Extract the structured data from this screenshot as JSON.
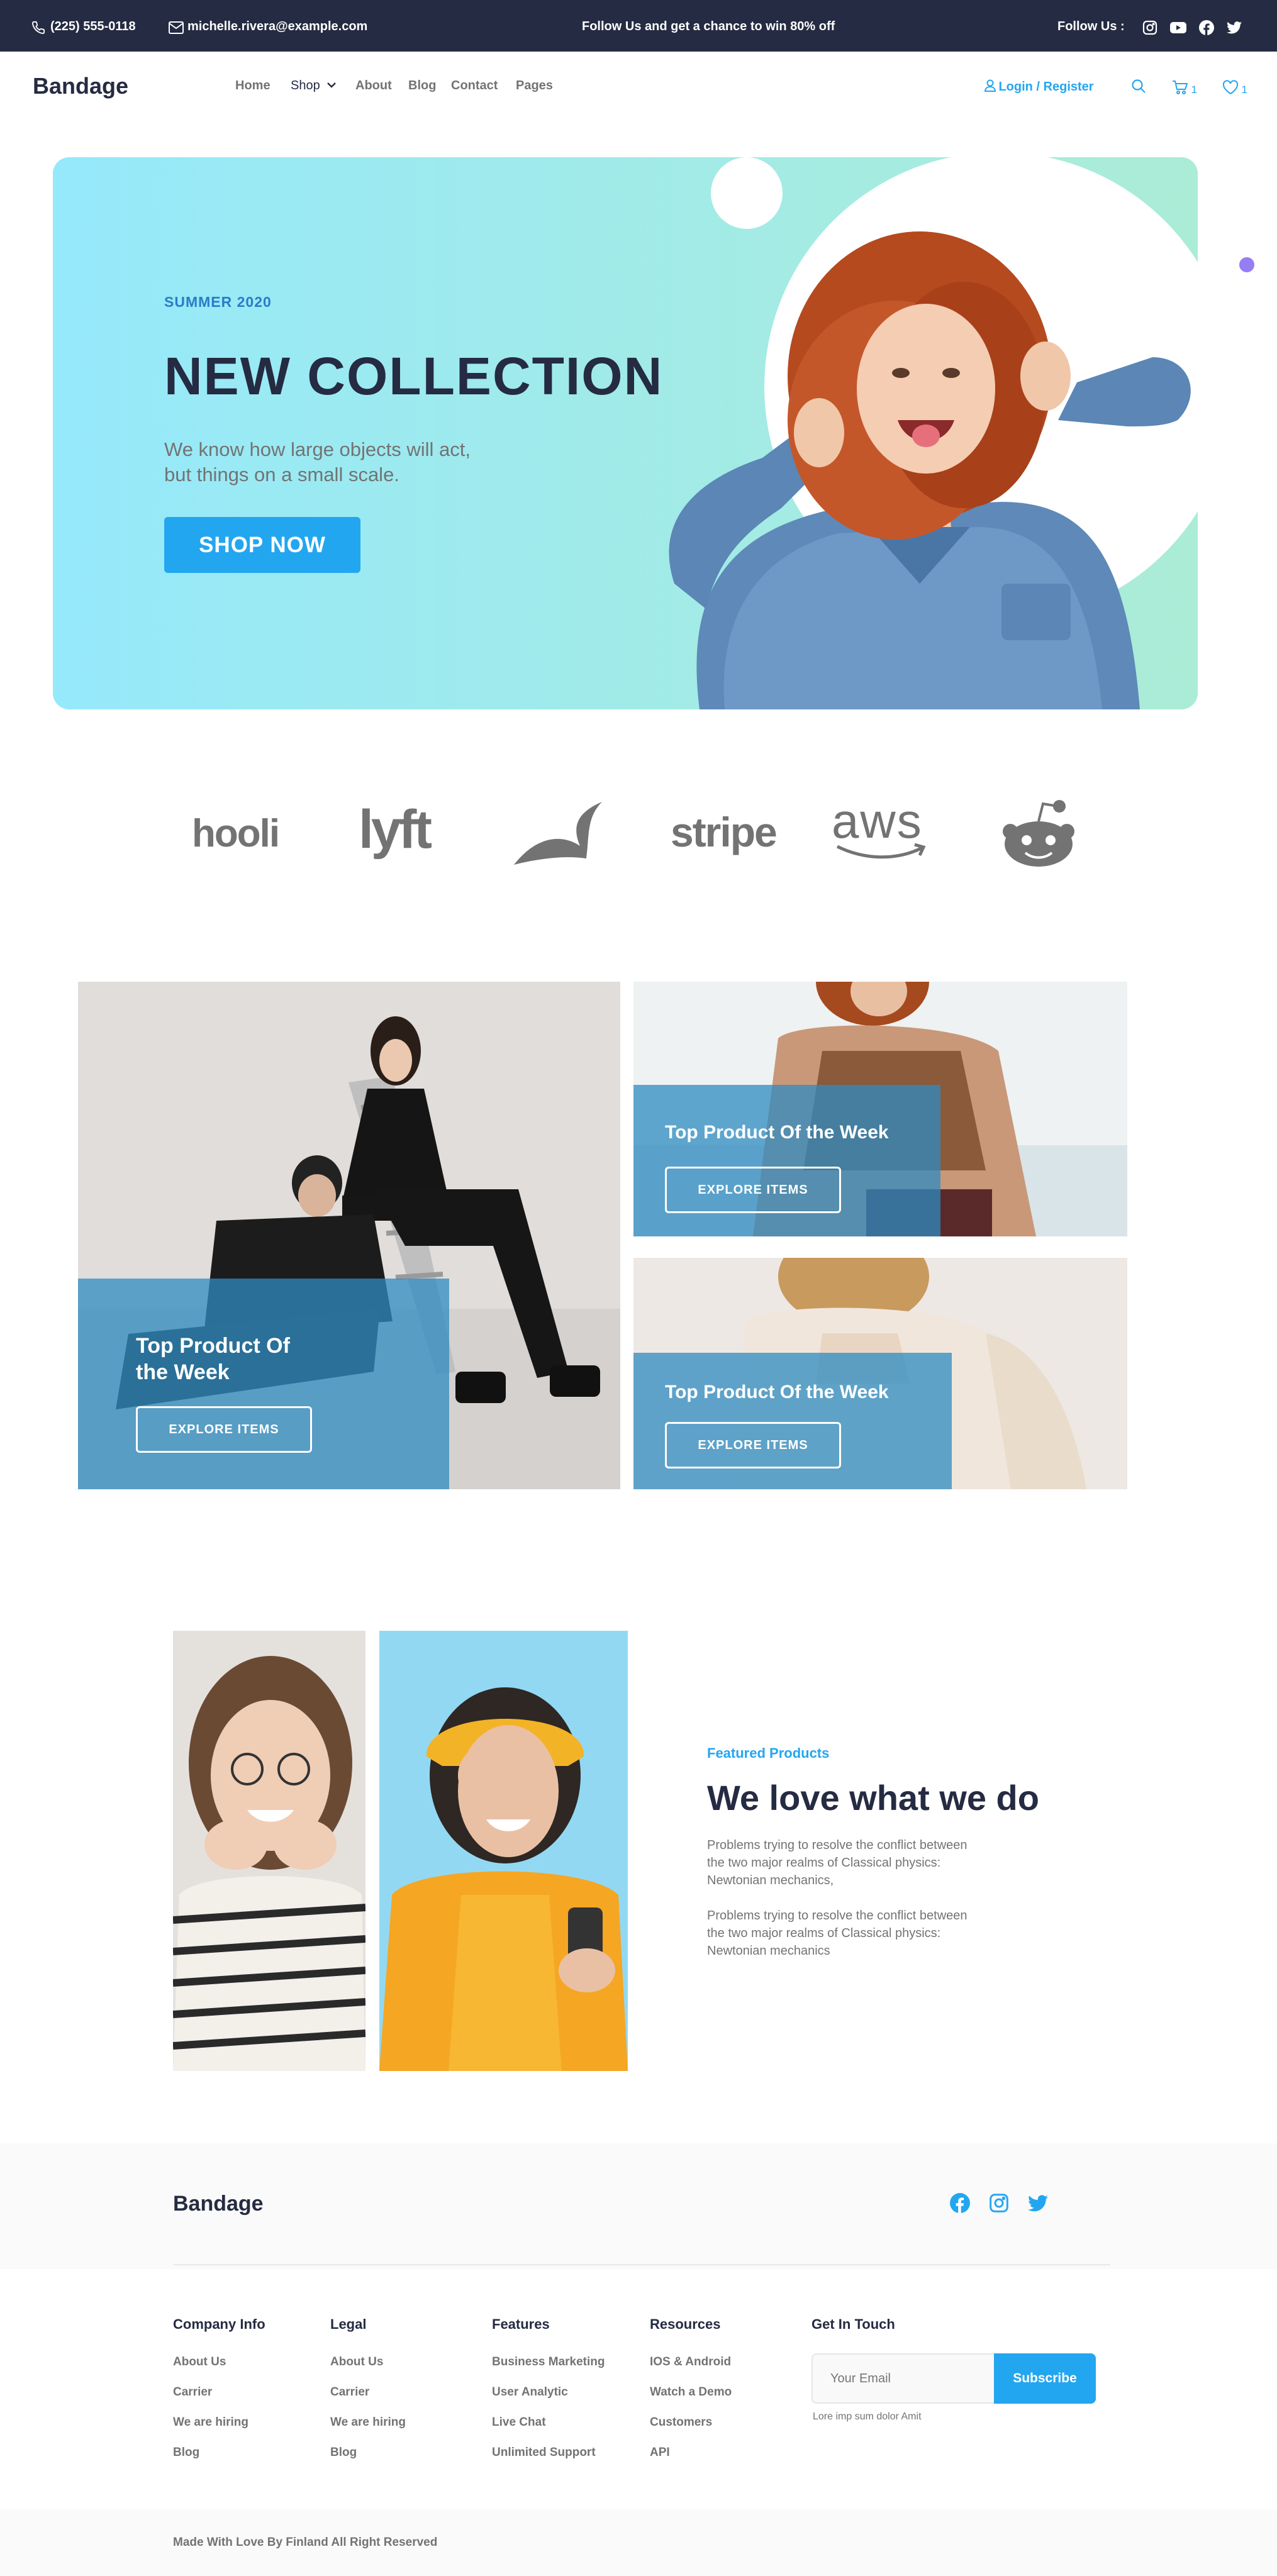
{
  "topbar": {
    "phone": "(225) 555-0118",
    "email": "michelle.rivera@example.com",
    "promo": "Follow Us  and get a chance to win 80% off",
    "follow_label": "Follow Us  :",
    "icons": [
      "instagram-icon",
      "youtube-icon",
      "facebook-icon",
      "twitter-icon"
    ]
  },
  "nav": {
    "brand": "Bandage",
    "links": [
      "Home",
      "Shop",
      "About",
      "Blog",
      "Contact",
      "Pages"
    ],
    "login": "Login / Register",
    "cart_count": "1",
    "wishlist_count": "1"
  },
  "hero": {
    "season": "SUMMER 2020",
    "title": "NEW COLLECTION",
    "desc_line1": "We know how large objects will act,",
    "desc_line2": "but things on a small scale.",
    "cta": "SHOP NOW"
  },
  "brands": [
    "hooli",
    "lyft",
    "leaf",
    "stripe",
    "aws",
    "reddit"
  ],
  "products": {
    "card1_title_line1": "Top Product Of",
    "card1_title_line2": "the Week",
    "card2_title": "Top Product Of the Week",
    "card3_title": "Top Product Of the Week",
    "cta": "EXPLORE ITEMS"
  },
  "featured": {
    "label": "Featured Products",
    "title": "We love what we do",
    "para1_line1": "Problems trying to resolve the conflict between",
    "para1_line2": "the two major realms of Classical physics:",
    "para1_line3": "Newtonian mechanics,",
    "para2_line1": "Problems trying to resolve the conflict between",
    "para2_line2": "the two major realms of Classical physics:",
    "para2_line3": "Newtonian mechanics"
  },
  "footer": {
    "brand": "Bandage",
    "columns": [
      {
        "title": "Company Info",
        "links": [
          "About Us",
          "Carrier",
          "We are hiring",
          "Blog"
        ]
      },
      {
        "title": "Legal",
        "links": [
          "About Us",
          "Carrier",
          "We are hiring",
          "Blog"
        ]
      },
      {
        "title": "Features",
        "links": [
          "Business Marketing",
          "User Analytic",
          "Live Chat",
          "Unlimited Support"
        ]
      },
      {
        "title": "Resources",
        "links": [
          "IOS & Android",
          "Watch a Demo",
          "Customers",
          "API"
        ]
      }
    ],
    "get_in_touch": "Get In Touch",
    "email_placeholder": "Your Email",
    "subscribe": "Subscribe",
    "subscribe_note": "Lore imp sum dolor Amit",
    "copyright": "Made With Love By Finland All Right Reserved"
  },
  "colors": {
    "primary": "#23A6F0",
    "dark": "#252B42",
    "muted": "#737373",
    "card_overlay": "#2D8BC0"
  }
}
